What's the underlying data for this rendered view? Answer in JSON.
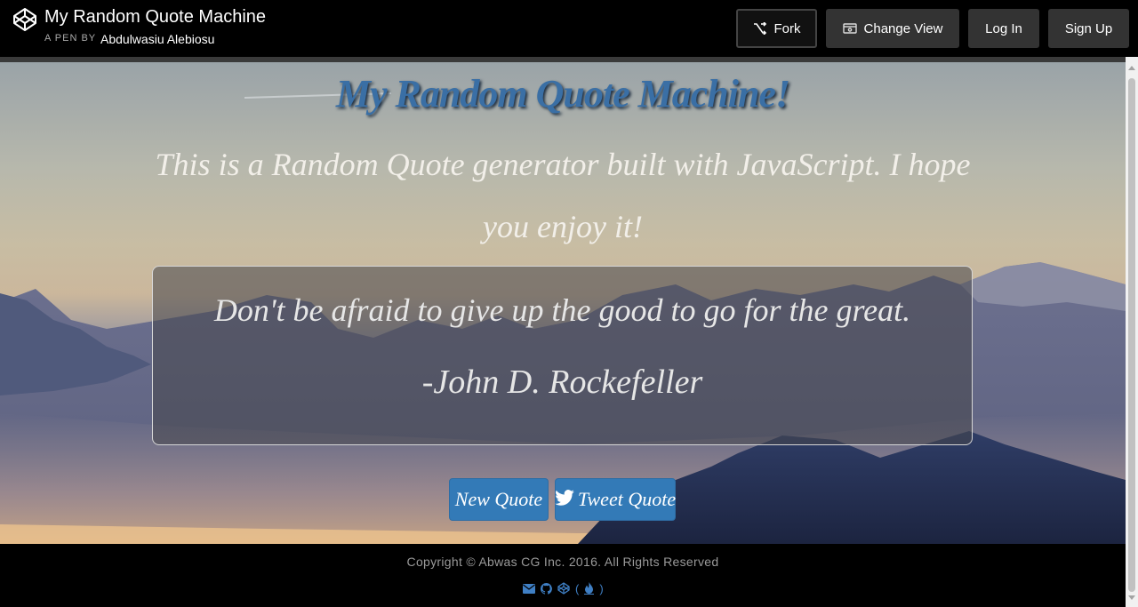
{
  "header": {
    "pen_title": "My Random Quote Machine",
    "pen_by": "A PEN BY",
    "author": "Abdulwasiu Alebiosu",
    "buttons": {
      "fork": "Fork",
      "change_view": "Change View",
      "log_in": "Log In",
      "sign_up": "Sign Up"
    }
  },
  "page": {
    "title": "My Random Quote Machine!",
    "subtitle": "This is a Random Quote generator built with JavaScript. I hope you enjoy it!",
    "quote": {
      "text": "Don't be afraid to give up the good to go for the great.",
      "author": "-John D. Rockefeller"
    },
    "buttons": {
      "new_quote": "New Quote",
      "tweet_quote": "Tweet Quote"
    }
  },
  "footer": {
    "copyright": "Copyright © Abwas CG Inc. 2016. All Rights Reserved",
    "paren_open": "(",
    "paren_close": ")",
    "icons": [
      "envelope-icon",
      "github-icon",
      "codepen-icon",
      "fire-icon"
    ]
  },
  "colors": {
    "accent": "#337ab7",
    "title": "#3a6fa5",
    "footer_link": "#3f7fc4"
  }
}
